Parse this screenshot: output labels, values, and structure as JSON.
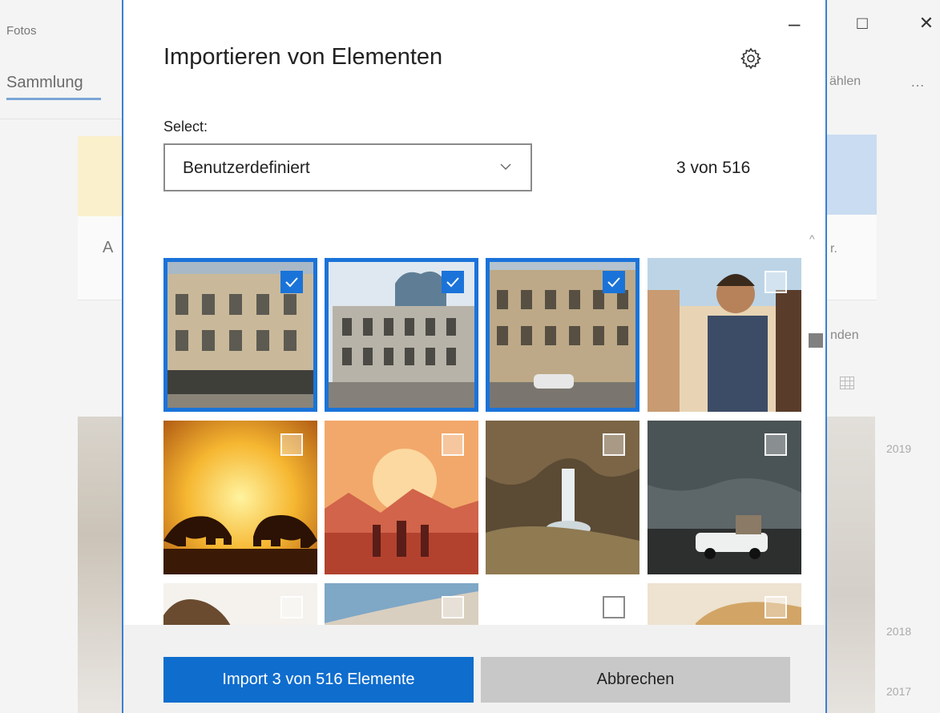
{
  "background_app": {
    "title": "Fotos",
    "tab": "Sammlung",
    "right_fragments": [
      "ählen",
      "r.",
      "nden"
    ],
    "years": [
      "2019",
      "2018",
      "2017"
    ],
    "card_letter": "A",
    "more": "…"
  },
  "window_controls": {
    "minimize": "–",
    "maximize": "□",
    "close": "✕"
  },
  "dialog": {
    "title": "Importieren von Elementen",
    "settings_icon": "gear-icon",
    "select_label": "Select:",
    "select_value": "Benutzerdefiniert",
    "count": "3 von 516",
    "minimize": "–"
  },
  "photos": [
    {
      "subject": "building-1",
      "selected": true
    },
    {
      "subject": "building-2",
      "selected": true
    },
    {
      "subject": "building-3",
      "selected": true
    },
    {
      "subject": "people-laughing",
      "selected": false
    },
    {
      "subject": "bears-sunset",
      "selected": false
    },
    {
      "subject": "cowboys-desert",
      "selected": false
    },
    {
      "subject": "waterfall",
      "selected": false
    },
    {
      "subject": "car-storm",
      "selected": false
    },
    {
      "subject": "rocks",
      "selected": false
    },
    {
      "subject": "hill",
      "selected": false
    },
    {
      "subject": "blank",
      "selected": false
    },
    {
      "subject": "dunes",
      "selected": false
    }
  ],
  "footer": {
    "import_label": "Import 3 von 516 Elemente",
    "cancel_label": "Abbrechen"
  },
  "colors": {
    "accent": "#0f6dce",
    "selection": "#1a73d9"
  }
}
